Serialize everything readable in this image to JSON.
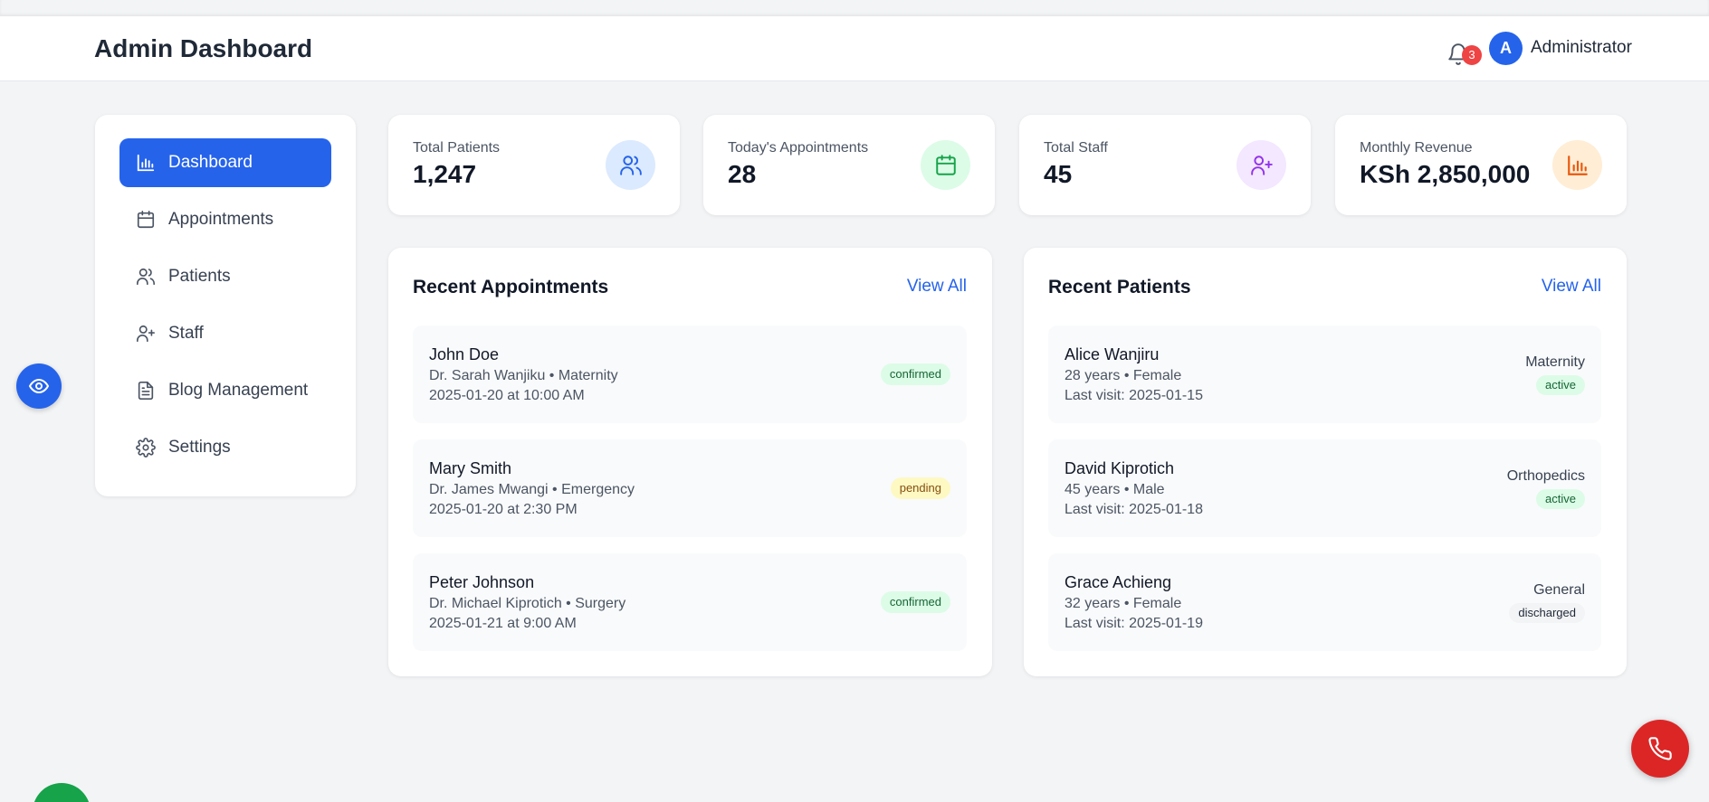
{
  "header": {
    "title": "Admin Dashboard",
    "notification_count": "3",
    "avatar_initial": "A",
    "user_name": "Administrator"
  },
  "sidebar": {
    "items": [
      {
        "label": "Dashboard",
        "icon": "bar-chart-icon",
        "active": true
      },
      {
        "label": "Appointments",
        "icon": "calendar-icon"
      },
      {
        "label": "Patients",
        "icon": "users-icon"
      },
      {
        "label": "Staff",
        "icon": "user-plus-icon"
      },
      {
        "label": "Blog Management",
        "icon": "document-icon"
      },
      {
        "label": "Settings",
        "icon": "gear-icon"
      }
    ]
  },
  "stats": [
    {
      "label": "Total Patients",
      "value": "1,247",
      "icon": "users-icon",
      "color": "#2563eb",
      "bg": "#dbeafe"
    },
    {
      "label": "Today's Appointments",
      "value": "28",
      "icon": "calendar-icon",
      "color": "#16a34a",
      "bg": "#dcfce7"
    },
    {
      "label": "Total Staff",
      "value": "45",
      "icon": "user-plus-icon",
      "color": "#9333ea",
      "bg": "#f3e8ff"
    },
    {
      "label": "Monthly Revenue",
      "value": "KSh 2,850,000",
      "icon": "bar-chart-icon",
      "color": "#ea580c",
      "bg": "#ffedd5"
    }
  ],
  "appointments": {
    "title": "Recent Appointments",
    "view_all": "View All",
    "rows": [
      {
        "name": "John Doe",
        "detail": "Dr. Sarah Wanjiku • Maternity",
        "time": "2025-01-20 at 10:00 AM",
        "status": "confirmed"
      },
      {
        "name": "Mary Smith",
        "detail": "Dr. James Mwangi • Emergency",
        "time": "2025-01-20 at 2:30 PM",
        "status": "pending"
      },
      {
        "name": "Peter Johnson",
        "detail": "Dr. Michael Kiprotich • Surgery",
        "time": "2025-01-21 at 9:00 AM",
        "status": "confirmed"
      }
    ]
  },
  "patients": {
    "title": "Recent Patients",
    "view_all": "View All",
    "rows": [
      {
        "name": "Alice Wanjiru",
        "detail": "28 years • Female",
        "visit": "Last visit: 2025-01-15",
        "department": "Maternity",
        "status": "active"
      },
      {
        "name": "David Kiprotich",
        "detail": "45 years • Male",
        "visit": "Last visit: 2025-01-18",
        "department": "Orthopedics",
        "status": "active"
      },
      {
        "name": "Grace Achieng",
        "detail": "32 years • Female",
        "visit": "Last visit: 2025-01-19",
        "department": "General",
        "status": "discharged"
      }
    ]
  },
  "colors": {
    "primary": "#2563eb",
    "danger": "#dc2626",
    "success": "#16a34a"
  }
}
